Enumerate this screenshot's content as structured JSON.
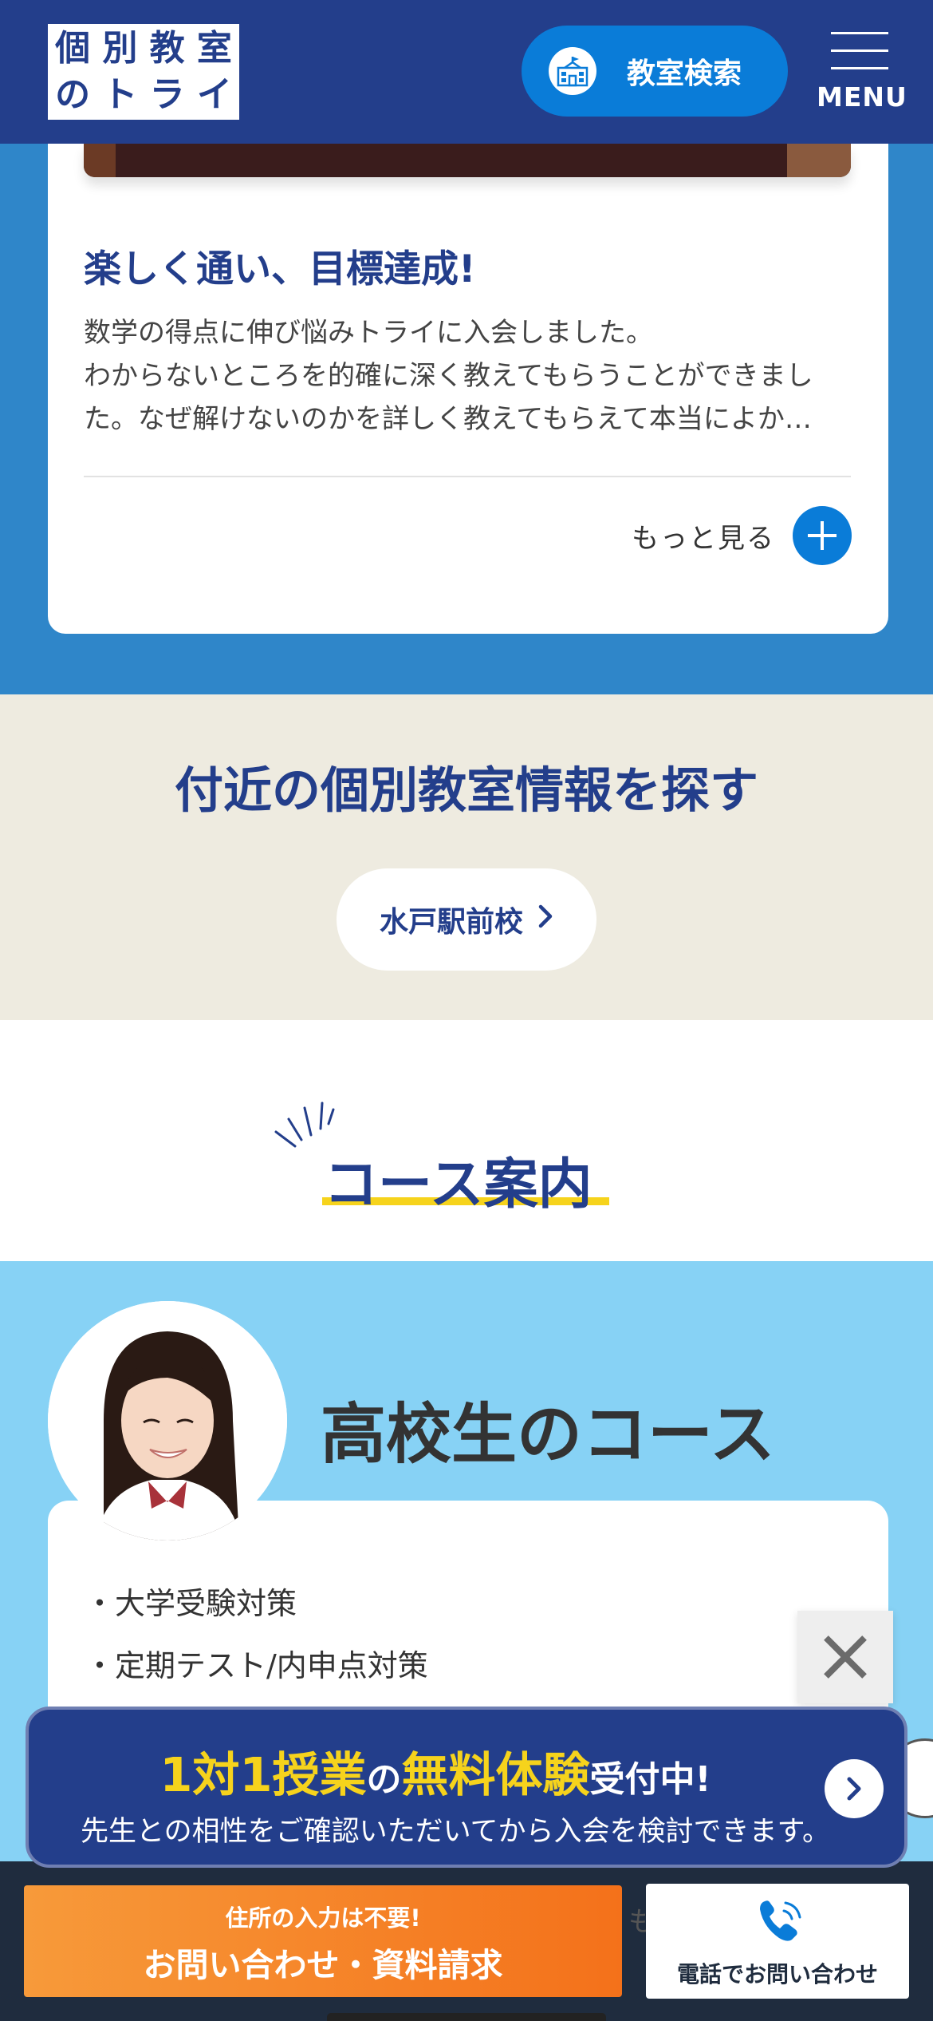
{
  "header": {
    "logo_chars": [
      "個",
      "別",
      "教",
      "室",
      "の",
      "ト",
      "ラ",
      "イ"
    ],
    "logo_alt": "個別教室のトライ",
    "search_label": "教室検索",
    "menu_label": "MENU"
  },
  "testimonial": {
    "title": "楽しく通い、目標達成!",
    "body_lines": [
      "数学の得点に伸び悩みトライに入会しました。",
      "わからないところを的確に深く教えてもらうことができまし",
      "た。なぜ解けないのかを詳しく教えてもらえて本当によか…"
    ],
    "more_label": "もっと見る"
  },
  "nearby": {
    "title": "付近の個別教室情報を探す",
    "school_label": "水戸駅前校"
  },
  "courses": {
    "heading": "コース案内",
    "high_school": {
      "name": "高校生のコース",
      "items": [
        "・大学受験対策",
        "・定期テスト/内申点対策"
      ]
    }
  },
  "trial_banner": {
    "part1": "1対1授業",
    "part2": "の",
    "part3": "無料体験",
    "part4": "受付中!",
    "subtitle": "先生との相性をご確認いただいてから入会を検討できます。"
  },
  "bottom_bar": {
    "contact_line1": "住所の入力は不要!",
    "contact_line2": "お問い合わせ・資料請求",
    "behind_char": "も",
    "phone_label": "電話でお問い合わせ"
  },
  "colors": {
    "navy": "#233e8b",
    "blue": "#0a7cd8",
    "section_blue": "#2f86c9",
    "light_blue": "#87d2f5",
    "beige": "#eeebe0",
    "yellow": "#f6d31c",
    "orange": "#f4711a"
  }
}
